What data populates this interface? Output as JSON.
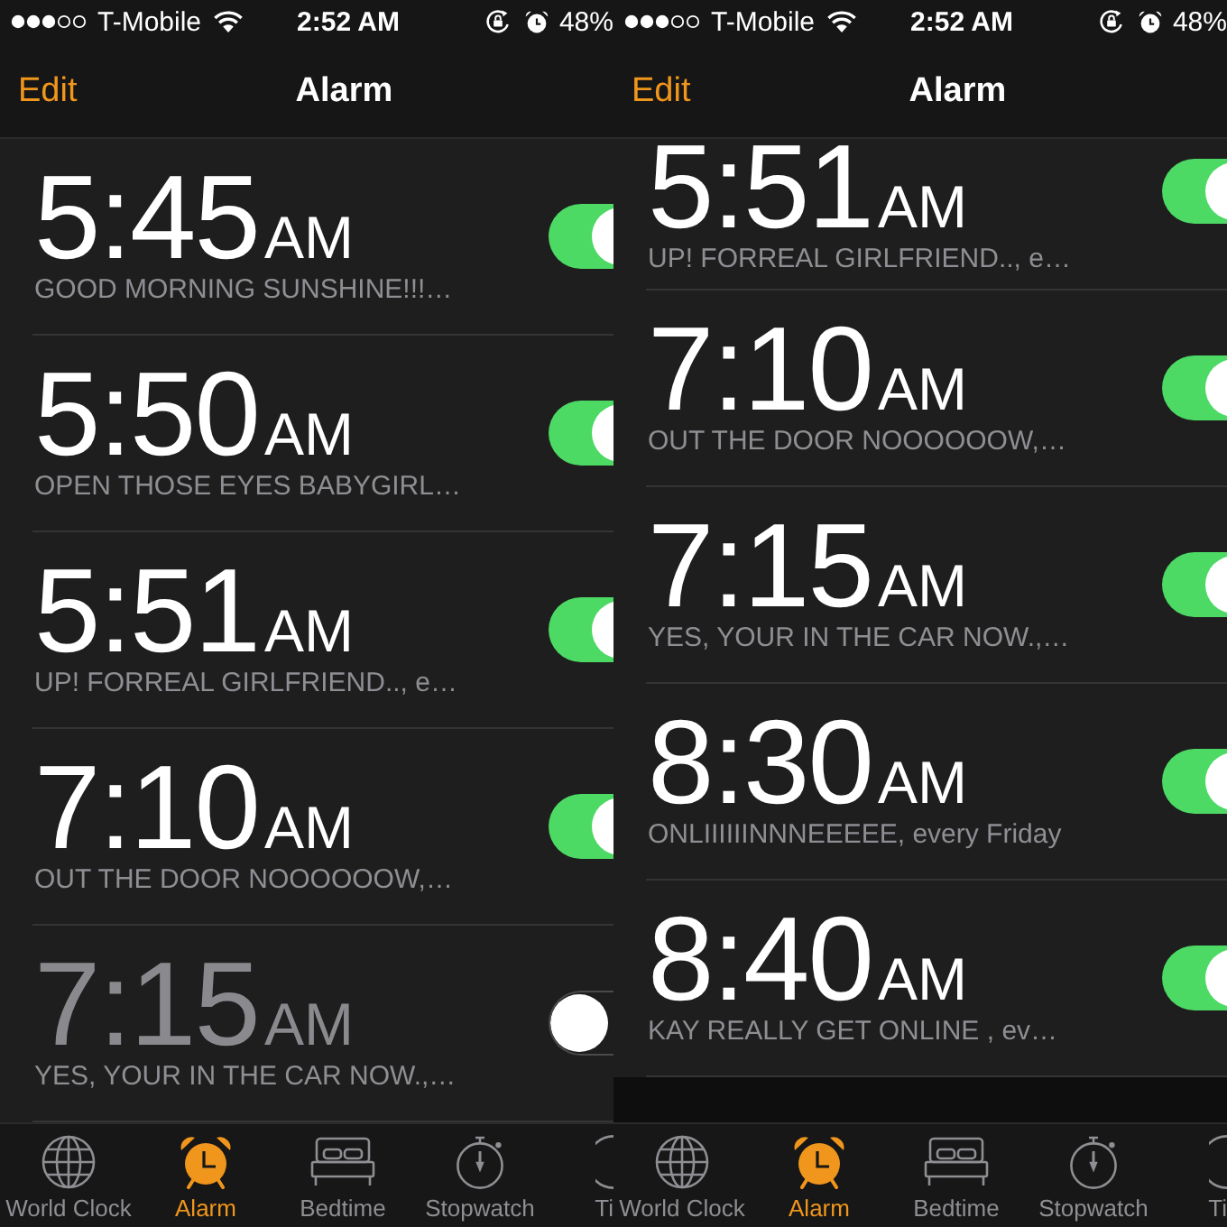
{
  "screens": [
    {
      "status_bar": {
        "carrier": "T-Mobile",
        "time": "2:52 AM",
        "battery": "48%"
      },
      "nav_bar": {
        "left_button": "Edit",
        "title": "Alarm"
      },
      "alarms": [
        {
          "time": "5:45",
          "period": "AM",
          "label": "GOOD MORNING SUNSHINE!!!…",
          "on": true
        },
        {
          "time": "5:50",
          "period": "AM",
          "label": "OPEN THOSE EYES BABYGIRL…",
          "on": true
        },
        {
          "time": "5:51",
          "period": "AM",
          "label": "UP! FORREAL GIRLFRIEND.., e…",
          "on": true
        },
        {
          "time": "7:10",
          "period": "AM",
          "label": "OUT THE DOOR NOOOOOOW,…",
          "on": true
        },
        {
          "time": "7:15",
          "period": "AM",
          "label": "YES, YOUR IN THE CAR NOW.,…",
          "on": false
        }
      ],
      "tab_bar": [
        {
          "label": "World Clock",
          "selected": false
        },
        {
          "label": "Alarm",
          "selected": true
        },
        {
          "label": "Bedtime",
          "selected": false
        },
        {
          "label": "Stopwatch",
          "selected": false
        },
        {
          "label": "Ti",
          "selected": false
        }
      ]
    },
    {
      "status_bar": {
        "carrier": "T-Mobile",
        "time": "2:52 AM",
        "battery": "48%"
      },
      "nav_bar": {
        "left_button": "Edit",
        "title": "Alarm"
      },
      "alarms": [
        {
          "time": "5:51",
          "period": "AM",
          "label": "UP! FORREAL GIRLFRIEND.., e…",
          "on": true
        },
        {
          "time": "7:10",
          "period": "AM",
          "label": "OUT THE DOOR NOOOOOOW,…",
          "on": true
        },
        {
          "time": "7:15",
          "period": "AM",
          "label": "YES, YOUR IN THE CAR NOW.,…",
          "on": true
        },
        {
          "time": "8:30",
          "period": "AM",
          "label": "ONLIIIIIINNNEEEEE, every Friday",
          "on": true
        },
        {
          "time": "8:40",
          "period": "AM",
          "label": "KAY REALLY GET ONLINE , ev…",
          "on": true
        }
      ],
      "tab_bar": [
        {
          "label": "World Clock",
          "selected": false
        },
        {
          "label": "Alarm",
          "selected": true
        },
        {
          "label": "Bedtime",
          "selected": false
        },
        {
          "label": "Stopwatch",
          "selected": false
        },
        {
          "label": "Ti",
          "selected": false
        }
      ]
    }
  ]
}
